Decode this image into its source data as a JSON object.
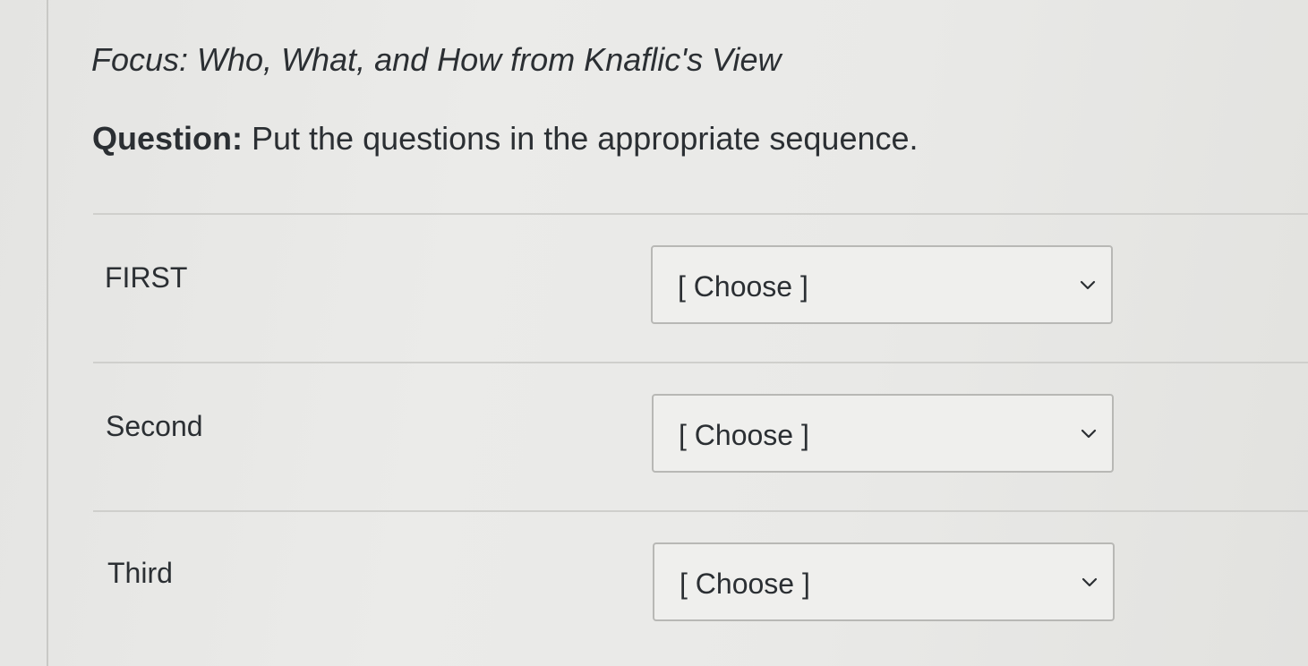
{
  "focus": {
    "text": "Focus: Who, What, and How from Knaflic's View"
  },
  "question": {
    "label": "Question:",
    "text": "Put the questions in the appropriate sequence."
  },
  "rows": [
    {
      "label": "FIRST",
      "selected": "[ Choose ]"
    },
    {
      "label": "Second",
      "selected": "[ Choose ]"
    },
    {
      "label": "Third",
      "selected": "[ Choose ]"
    }
  ],
  "icons": {
    "dropdown": "chevron-down-icon"
  },
  "colors": {
    "text": "#2b2f33",
    "border": "#b8b8b5",
    "background": "#e9e9e7"
  }
}
